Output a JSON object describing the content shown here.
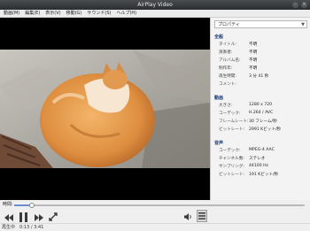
{
  "window": {
    "title": "AirPlay Video"
  },
  "menu": [
    "動画(M)",
    "編集(E)",
    "表示(V)",
    "移動(G)",
    "サウンド(S)",
    "ヘルプ(H)"
  ],
  "panel": {
    "dropdown": "プロパティ",
    "sections": {
      "general": {
        "title": "全般",
        "rows": [
          {
            "k": "タイトル:",
            "v": "不明"
          },
          {
            "k": "演奏者:",
            "v": "不明"
          },
          {
            "k": "アルバム名:",
            "v": "不明"
          },
          {
            "k": "制作年:",
            "v": "不明"
          },
          {
            "k": "再生時間:",
            "v": "3 分 41 秒"
          },
          {
            "k": "コメント:",
            "v": ""
          }
        ]
      },
      "video": {
        "title": "動画",
        "rows": [
          {
            "k": "大きさ:",
            "v": "1280 x 720"
          },
          {
            "k": "コーデック:",
            "v": "H.264 / AVC"
          },
          {
            "k": "フレームレート:",
            "v": "30 フレーム/秒"
          },
          {
            "k": "ビットレート:",
            "v": "2991 Kビット/秒"
          }
        ]
      },
      "audio": {
        "title": "音声",
        "rows": [
          {
            "k": "コーデック:",
            "v": "MPEG-4 AAC"
          },
          {
            "k": "チャンネル数:",
            "v": "ステレオ"
          },
          {
            "k": "サンプリング:",
            "v": "44100 Hz"
          },
          {
            "k": "ビットレート:",
            "v": "191 Kビット/秒"
          }
        ]
      }
    }
  },
  "seek": {
    "label": "時間:",
    "progress": 0.06
  },
  "status": "再生中　0:13 / 3:41",
  "icons": {
    "rewind": "rewind-icon",
    "pause": "pause-icon",
    "forward": "fast-forward-icon",
    "fullscreen": "fullscreen-icon",
    "volume": "volume-icon",
    "sidebar": "sidebar-toggle-icon"
  },
  "colors": {
    "accent": "#6a8fcf",
    "section_title": "#1a3d7c"
  }
}
